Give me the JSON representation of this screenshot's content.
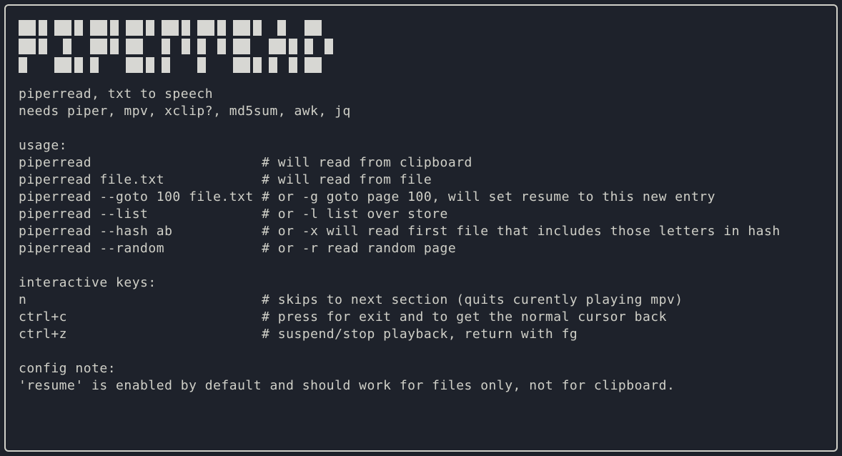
{
  "logo_text": "PIPERREAD",
  "intro": [
    "piperread, txt to speech",
    "needs piper, mpv, xclip?, md5sum, awk, jq"
  ],
  "usage_header": "usage:",
  "usage": [
    "piperread                     # will read from clipboard",
    "piperread file.txt            # will read from file",
    "piperread --goto 100 file.txt # or -g goto page 100, will set resume to this new entry",
    "piperread --list              # or -l list over store",
    "piperread --hash ab           # or -x will read first file that includes those letters in hash",
    "piperread --random            # or -r read random page"
  ],
  "keys_header": "interactive keys:",
  "keys": [
    "n                             # skips to next section (quits curently playing mpv)",
    "ctrl+c                        # press for exit and to get the normal cursor back",
    "ctrl+z                        # suspend/stop playback, return with fg"
  ],
  "config_header": "config note:",
  "config": [
    "'resume' is enabled by default and should work for files only, not for clipboard."
  ]
}
